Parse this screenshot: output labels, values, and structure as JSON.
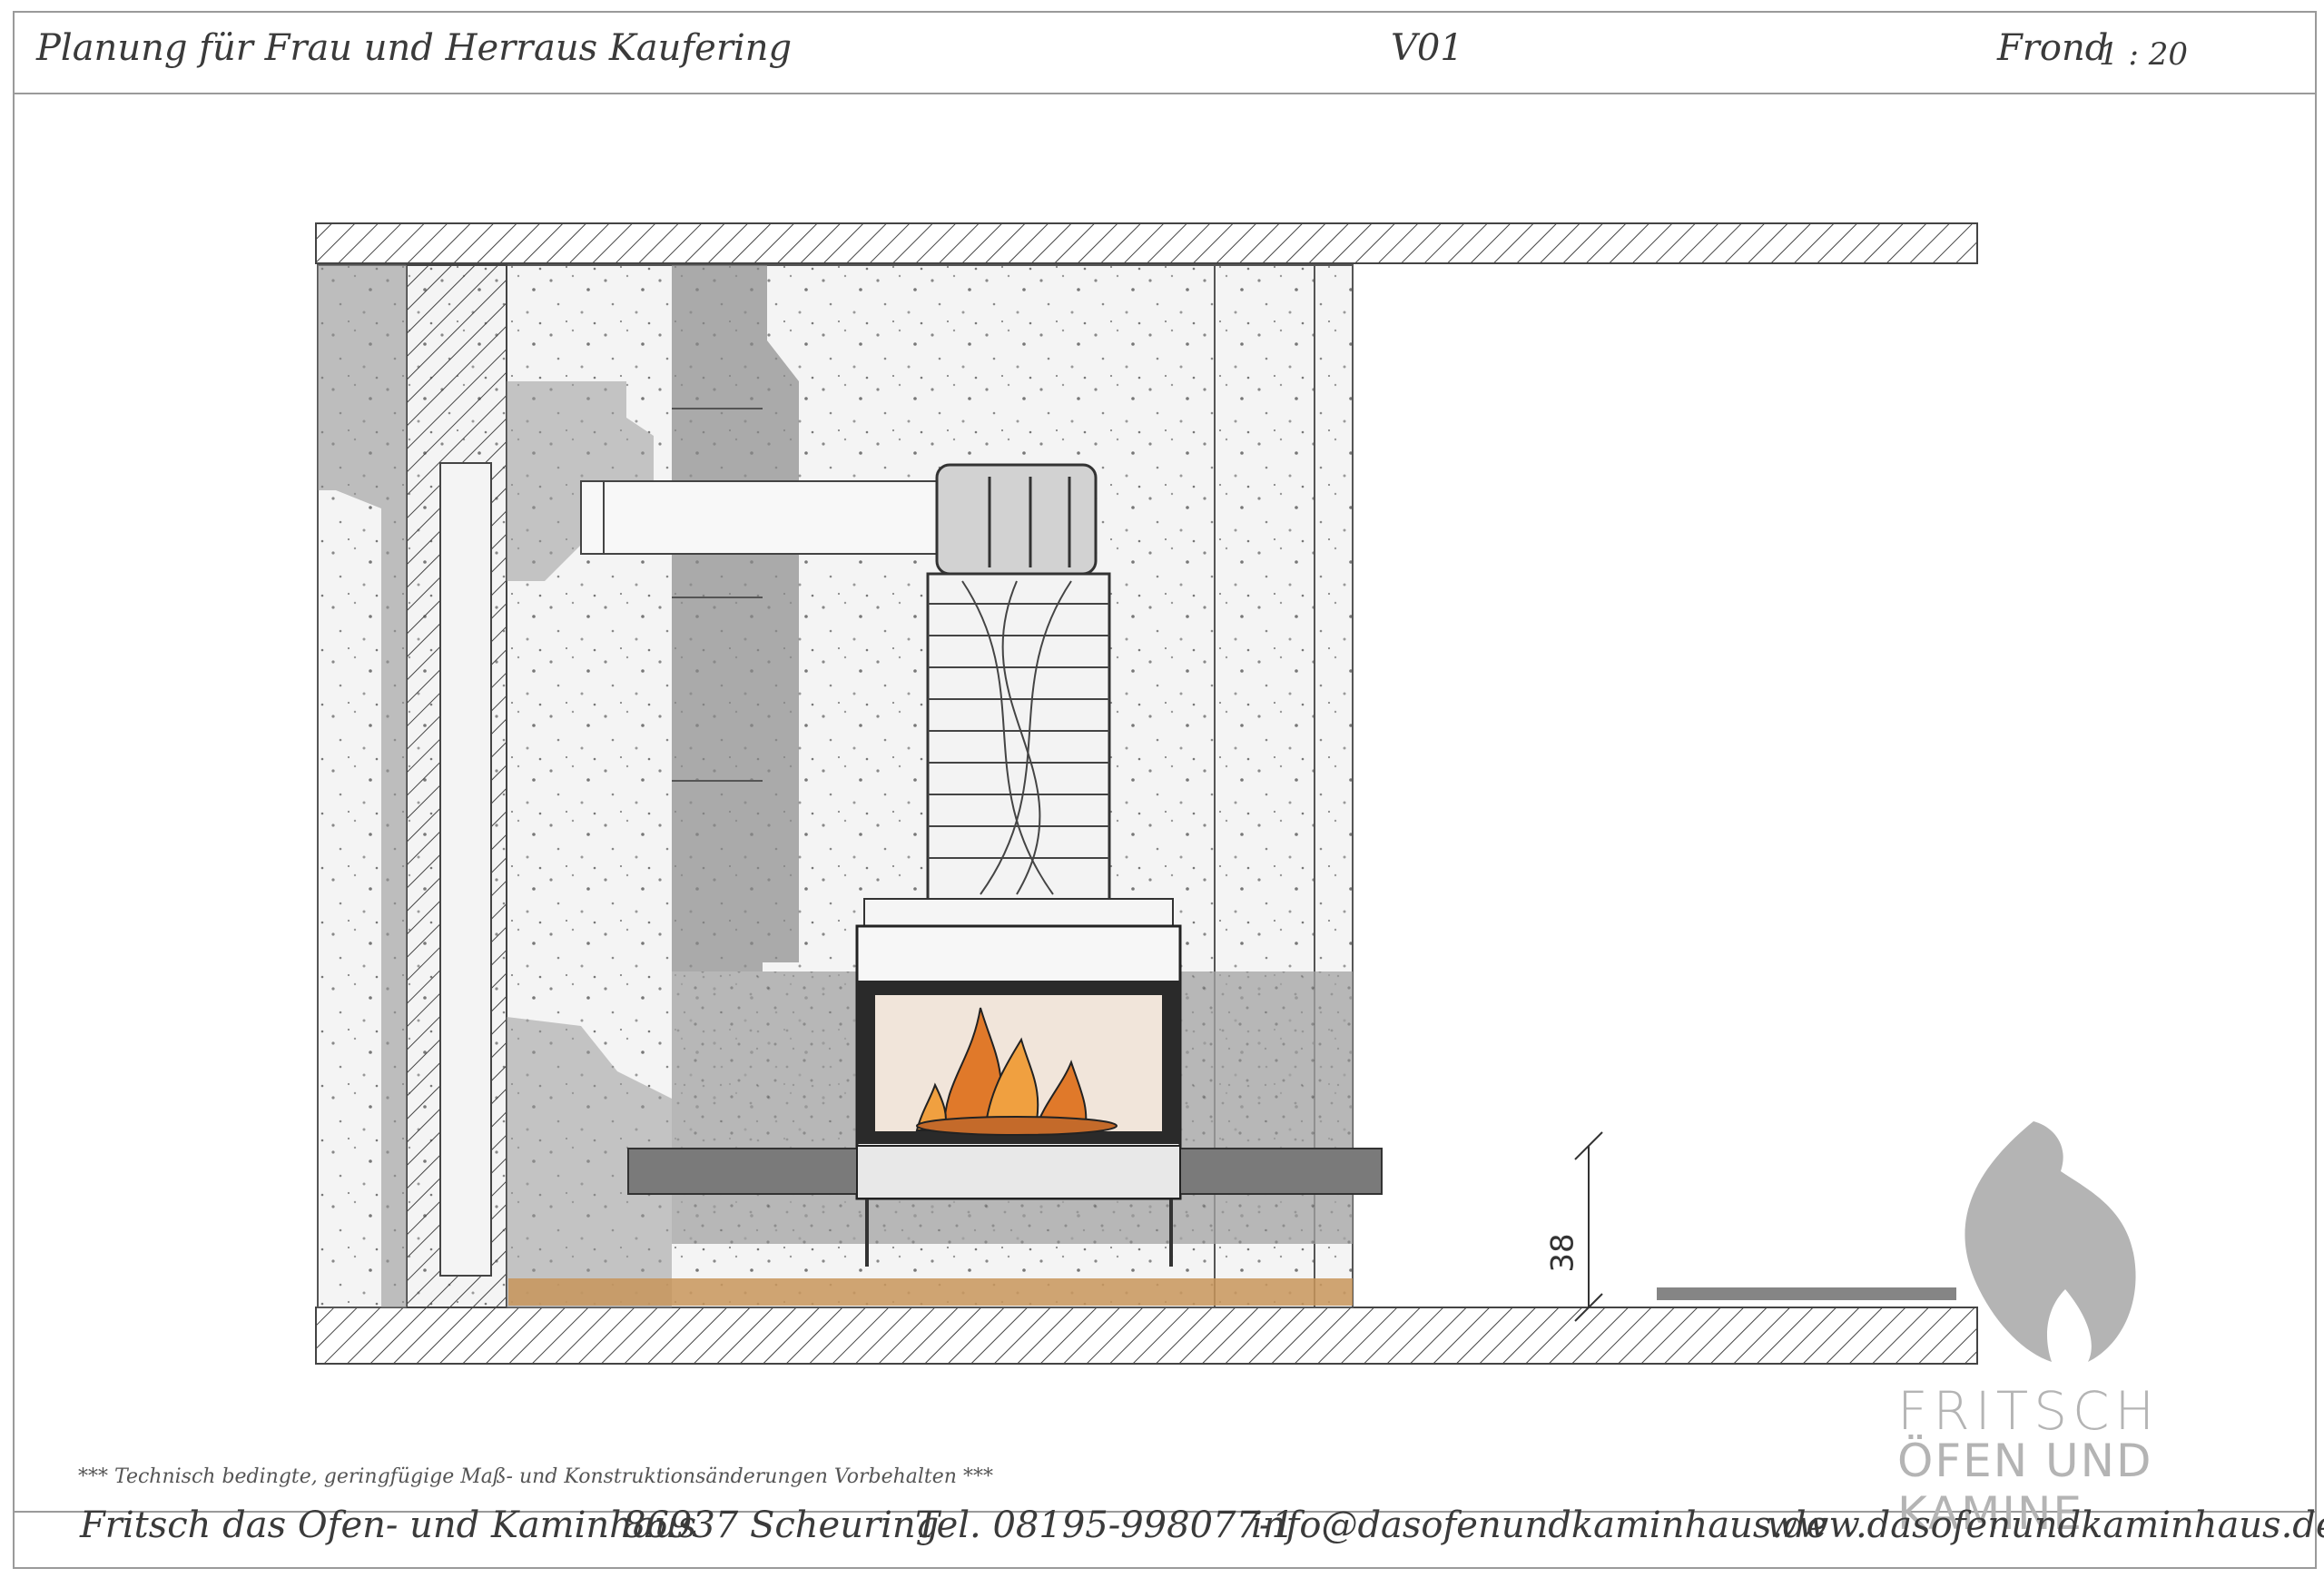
{
  "header": {
    "client": "Planung für Frau und Herr",
    "location": "aus Kaufering",
    "version": "V01",
    "view_label": "Frond",
    "scale": "1 : 20"
  },
  "drawing": {
    "dimension_label": "38"
  },
  "footnote": "***   Technisch bedingte, geringfügige Maß- und Konstruktionsänderungen Vorbehalten   ***",
  "logo": {
    "line1": "FRITSCH",
    "line2": "ÖFEN UND KAMINE"
  },
  "footer": {
    "company": "Fritsch das Ofen- und Kaminhaus",
    "city": "86937 Scheuring",
    "phone": "Tel. 08195-998077-1",
    "email": "info@dasofenundkaminhaus.de",
    "web": "www.dasofenundkaminhaus.de"
  },
  "colors": {
    "concrete": "#d8d8d8",
    "dark_stone": "#7a7a7a",
    "wood_floor": "#c8955a",
    "fire_orange": "#e0792a",
    "logo_grey": "#b4b4b4"
  }
}
